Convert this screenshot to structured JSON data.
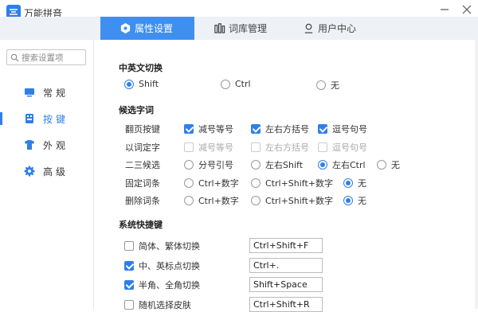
{
  "app": {
    "title": "万能拼音"
  },
  "tabs": [
    {
      "label": "属性设置",
      "icon": "hexagon-settings-icon",
      "active": true
    },
    {
      "label": "词库管理",
      "icon": "library-icon",
      "active": false
    },
    {
      "label": "用户中心",
      "icon": "user-icon",
      "active": false
    }
  ],
  "sidebar": {
    "search_placeholder": "搜索设置项",
    "items": [
      {
        "label": "常规",
        "icon": "monitor-icon",
        "active": false
      },
      {
        "label": "按键",
        "icon": "keyboard-icon",
        "active": true
      },
      {
        "label": "外观",
        "icon": "shirt-icon",
        "active": false
      },
      {
        "label": "高级",
        "icon": "gear-icon",
        "active": false
      }
    ]
  },
  "switch_section": {
    "title": "中英文切换",
    "options": [
      "Shift",
      "Ctrl",
      "无"
    ],
    "selected": "Shift"
  },
  "candidate_section": {
    "title": "候选字词",
    "page_keys": {
      "label": "翻页按键",
      "options": [
        "减号等号",
        "左右方括号",
        "逗号句号"
      ],
      "checked": [
        true,
        true,
        true
      ]
    },
    "word_select": {
      "label": "以词定字",
      "options": [
        "减号等号",
        "左右方括号",
        "逗号句号"
      ],
      "checked": [
        false,
        false,
        false
      ]
    },
    "second_third": {
      "label": "二三候选",
      "options": [
        "分号引号",
        "左右Shift",
        "左右Ctrl",
        "无"
      ],
      "selected": "左右Ctrl"
    },
    "pin_word": {
      "label": "固定词条",
      "options": [
        "Ctrl+数字",
        "Ctrl+Shift+数字",
        "无"
      ],
      "selected": "无"
    },
    "delete_word": {
      "label": "删除词条",
      "options": [
        "Ctrl+数字",
        "Ctrl+Shift+数字",
        "无"
      ],
      "selected": "无"
    }
  },
  "hotkey_section": {
    "title": "系统快捷键",
    "items": [
      {
        "label": "简体、繁体切换",
        "checked": false,
        "value": "Ctrl+Shift+F"
      },
      {
        "label": "中、英标点切换",
        "checked": true,
        "value": "Ctrl+."
      },
      {
        "label": "半角、全角切换",
        "checked": true,
        "value": "Shift+Space"
      },
      {
        "label": "随机选择皮肤",
        "checked": false,
        "value": "Ctrl+Shift+R"
      }
    ]
  },
  "colors": {
    "accent": "#2f7fe8",
    "tab_active": "#3f8ff0",
    "tab_bar_bg": "#eef1f5"
  }
}
